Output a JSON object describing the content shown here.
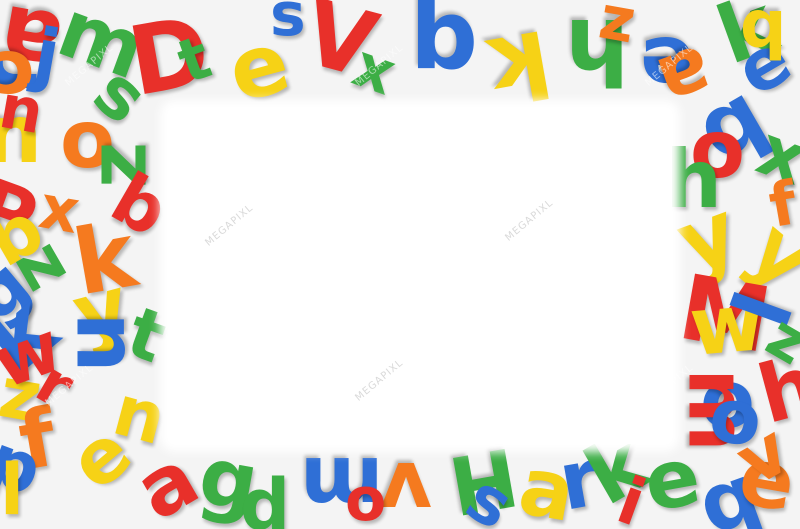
{
  "image": {
    "subject": "magnetic-letter-frame",
    "watermark_text": "MEGAPIXL",
    "colors": {
      "red": "#e8302a",
      "orange": "#f57a1f",
      "yellow": "#f6d216",
      "green": "#3cae45",
      "blue": "#2f6fd6",
      "center": "#ffffff"
    }
  }
}
